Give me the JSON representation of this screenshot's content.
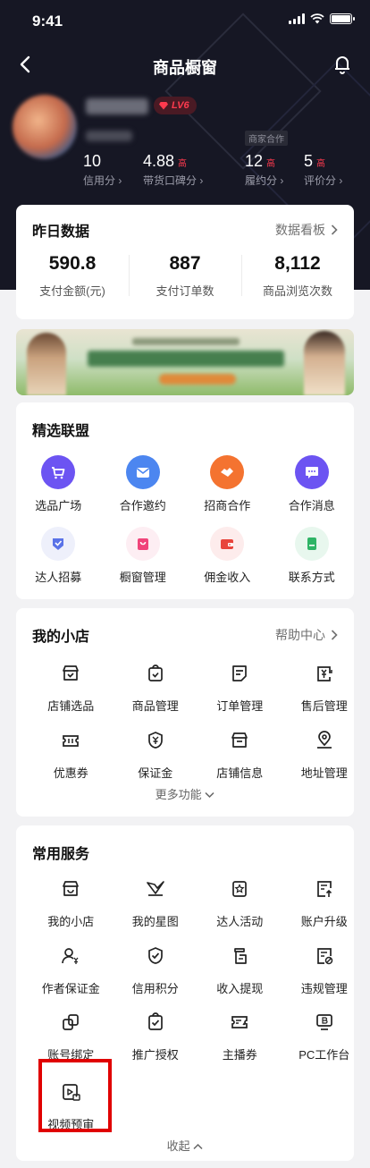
{
  "status_bar": {
    "time": "9:41"
  },
  "nav": {
    "title": "商品橱窗"
  },
  "profile": {
    "level": "LV6",
    "shop_tag": "商家合作",
    "metrics": [
      {
        "value": "10",
        "hi": "",
        "label": "信用分 ›"
      },
      {
        "value": "4.88",
        "hi": "高",
        "label": "带货口碑分 ›"
      },
      {
        "value": "12",
        "hi": "高",
        "label": "履约分 ›"
      },
      {
        "value": "5",
        "hi": "高",
        "label": "评价分 ›"
      }
    ]
  },
  "yesterday": {
    "title": "昨日数据",
    "link": "数据看板",
    "stats": [
      {
        "value": "590.8",
        "label": "支付金额(元)"
      },
      {
        "value": "887",
        "label": "支付订单数"
      },
      {
        "value": "8,112",
        "label": "商品浏览次数"
      }
    ]
  },
  "alliance": {
    "title": "精选联盟",
    "items": [
      {
        "label": "选品广场",
        "icon": "cart-icon"
      },
      {
        "label": "合作邀约",
        "icon": "mail-icon"
      },
      {
        "label": "招商合作",
        "icon": "handshake-icon"
      },
      {
        "label": "合作消息",
        "icon": "message-icon"
      },
      {
        "label": "达人招募",
        "icon": "recruit-icon"
      },
      {
        "label": "橱窗管理",
        "icon": "bag-icon"
      },
      {
        "label": "佣金收入",
        "icon": "wallet-icon"
      },
      {
        "label": "联系方式",
        "icon": "phone-icon"
      }
    ]
  },
  "my_shop": {
    "title": "我的小店",
    "link": "帮助中心",
    "items": [
      {
        "label": "店铺选品",
        "icon": "store-select-icon"
      },
      {
        "label": "商品管理",
        "icon": "goods-manage-icon"
      },
      {
        "label": "订单管理",
        "icon": "order-icon"
      },
      {
        "label": "售后管理",
        "icon": "after-sale-icon"
      },
      {
        "label": "优惠券",
        "icon": "coupon-icon"
      },
      {
        "label": "保证金",
        "icon": "deposit-icon"
      },
      {
        "label": "店铺信息",
        "icon": "store-info-icon"
      },
      {
        "label": "地址管理",
        "icon": "location-icon"
      }
    ],
    "more": "更多功能"
  },
  "services": {
    "title": "常用服务",
    "items": [
      {
        "label": "我的小店",
        "icon": "store-icon"
      },
      {
        "label": "我的星图",
        "icon": "star-map-icon"
      },
      {
        "label": "达人活动",
        "icon": "activity-icon"
      },
      {
        "label": "账户升级",
        "icon": "upgrade-icon"
      },
      {
        "label": "作者保证金",
        "icon": "author-deposit-icon"
      },
      {
        "label": "信用积分",
        "icon": "credit-icon"
      },
      {
        "label": "收入提现",
        "icon": "withdraw-icon"
      },
      {
        "label": "违规管理",
        "icon": "violation-icon"
      },
      {
        "label": "账号绑定",
        "icon": "bind-icon"
      },
      {
        "label": "推广授权",
        "icon": "authorize-icon"
      },
      {
        "label": "主播券",
        "icon": "anchor-coupon-icon"
      },
      {
        "label": "PC工作台",
        "icon": "pc-icon"
      },
      {
        "label": "视频预审",
        "icon": "video-review-icon"
      }
    ],
    "collapse": "收起"
  }
}
